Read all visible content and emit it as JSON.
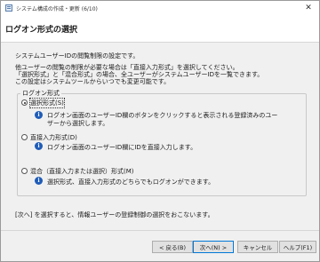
{
  "window": {
    "title": "システム構成の作成・更新 (6/10)",
    "close_symbol": "✕"
  },
  "header": {
    "page_title": "ログオン形式の選択"
  },
  "intro": {
    "line1": "システムユーザーIDの閲覧制限の設定です。",
    "line2": "他ユーザーの閲覧の制限が必要な場合は「直接入力形式」を選択してください。",
    "line3": "「選択形式」と「混合形式」の場合、全ユーザーがシステムユーザーIDを一覧できます。",
    "line4": "この設定はシステムツールからいつでも変更可能です。"
  },
  "logon_group": {
    "label": "ログオン形式",
    "options": [
      {
        "label": "選択形式(S)",
        "selected": true,
        "desc_line1": "ログオン画面のユーザーID欄のボタンをクリックすると表示される登録済みのユー",
        "desc_line2": "ザーから選択します。"
      },
      {
        "label": "直接入力形式(D)",
        "selected": false,
        "desc_line1": "ログオン画面のユーザーID欄にIDを直接入力します。"
      },
      {
        "label": "混合（直接入力または選択）形式(M)",
        "selected": false,
        "desc_line1": "選択形式、直接入力形式のどちらでもログオンができます。"
      }
    ]
  },
  "footer_note": "[次へ] を選択すると、情報ユーザーの登録制御の選択をおこないます。",
  "buttons": {
    "back": "< 戻る(B)",
    "next": "次へ(N) >",
    "cancel": "キャンセル",
    "help": "ヘルプ(F1)"
  }
}
